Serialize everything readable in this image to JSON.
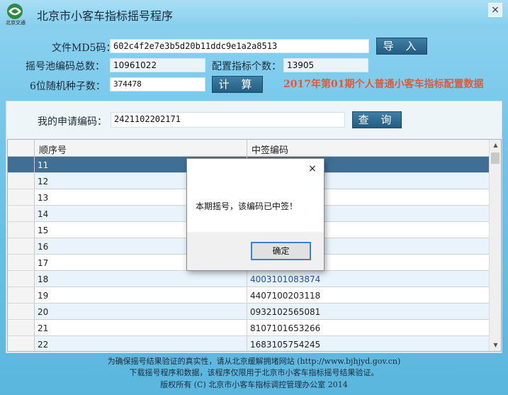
{
  "window": {
    "logo_text": "北京交通",
    "title": "北京市小客车指标摇号程序",
    "close_glyph": "×"
  },
  "form": {
    "md5_label": "文件MD5码：",
    "md5_value": "602c4f2e7e3b5d20b11ddc9e1a2a8513",
    "import_button": "导 入",
    "pool_total_label": "摇号池编码总数：",
    "pool_total_value": "10961022",
    "quota_label": "配置指标个数：",
    "quota_value": "13905",
    "seed_label": "6位随机种子数：",
    "seed_value": "374478",
    "calc_button": "计 算",
    "period_note": "2017年第01期个人普通小客车指标配置数据"
  },
  "query": {
    "code_label": "我的申请编码：",
    "code_value": "2421102202171",
    "query_button": "查 询"
  },
  "table": {
    "columns": [
      "顺序号",
      "中签编码"
    ],
    "rows": [
      {
        "seq": "11",
        "code": ""
      },
      {
        "seq": "12",
        "code": ""
      },
      {
        "seq": "13",
        "code": ""
      },
      {
        "seq": "14",
        "code": ""
      },
      {
        "seq": "15",
        "code": ""
      },
      {
        "seq": "16",
        "code": ""
      },
      {
        "seq": "17",
        "code": ""
      },
      {
        "seq": "18",
        "code": "4003101083874"
      },
      {
        "seq": "19",
        "code": "4407100203118"
      },
      {
        "seq": "20",
        "code": "0932102565081"
      },
      {
        "seq": "21",
        "code": "8107101653266"
      },
      {
        "seq": "22",
        "code": "1683105754245"
      }
    ]
  },
  "dialog": {
    "close_glyph": "×",
    "message": "本期摇号，该编码已中签！",
    "ok_button": "确定"
  },
  "footer": {
    "line1": "为确保摇号结果验证的真实性，请从北京缓解拥堵网站 (http://www.bjhjyd.gov.cn)",
    "line2": "下载摇号程序和数据，该程序仅限用于北京市小客车指标摇号结果验证。",
    "line3": "版权所有 (C) 北京市小客车指标调控管理办公室 2014"
  }
}
